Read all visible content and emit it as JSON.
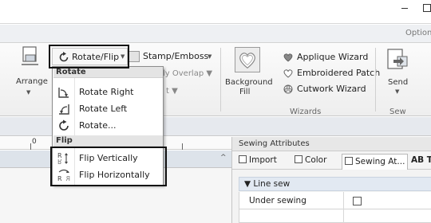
{
  "window": {
    "minimize_glyph": "–",
    "option_tab": "Option"
  },
  "ribbon": {
    "arrange": {
      "label": "Arrange"
    },
    "rotate_flip": {
      "label": "Rotate/Flip"
    },
    "stamp_emboss": {
      "label": "Stamp/Emboss"
    },
    "behind_text_1": "ly Overlap",
    "behind_text_2": "t",
    "background_fill": {
      "line1": "Background",
      "line2": "Fill"
    },
    "wizards": {
      "caption": "Wizards",
      "items": [
        {
          "label": "Applique Wizard",
          "icon": "heart-icon"
        },
        {
          "label": "Embroidered Patch",
          "icon": "heart-outline-icon"
        },
        {
          "label": "Cutwork Wizard",
          "icon": "cutwork-icon"
        }
      ]
    },
    "send": {
      "label": "Send",
      "caption": "Sew"
    }
  },
  "dropdown": {
    "sections": [
      {
        "header": "Rotate",
        "items": [
          {
            "label": "Rotate Right",
            "icon": "rotate-right-icon"
          },
          {
            "label": "Rotate Left",
            "icon": "rotate-left-icon"
          },
          {
            "label": "Rotate...",
            "icon": "rotate-free-icon"
          }
        ]
      },
      {
        "header": "Flip",
        "items": [
          {
            "label": "Flip Vertically",
            "icon": "flip-vertical-icon"
          },
          {
            "label": "Flip Horizontally",
            "icon": "flip-horizontal-icon"
          }
        ]
      }
    ]
  },
  "ruler": {
    "zero": "0"
  },
  "sewing_panel": {
    "title": "Sewing Attributes",
    "tabs": [
      {
        "label": "Import"
      },
      {
        "label": "Color"
      },
      {
        "label": "Sewing At..."
      },
      {
        "label": "AB Te"
      }
    ],
    "group": "▼ Line sew",
    "rows": [
      {
        "label": "Under sewing",
        "checked": false
      }
    ]
  },
  "colors": {
    "highlight_border": "#111111",
    "section_header_bg": "#e4e4e4"
  }
}
